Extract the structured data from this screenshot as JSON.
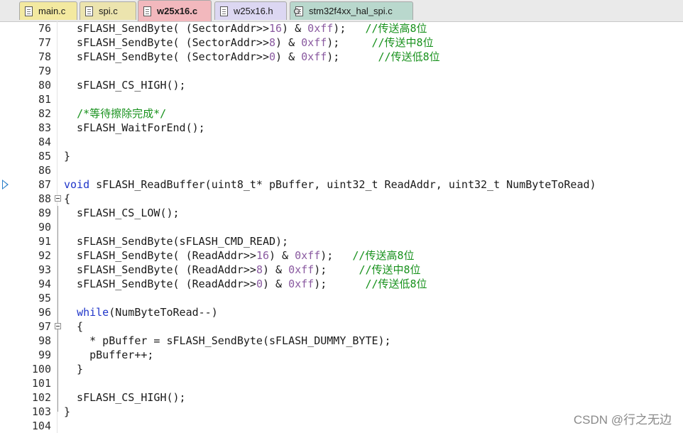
{
  "tabs": [
    {
      "label": "main.c",
      "color": "#f3e9a0"
    },
    {
      "label": "spi.c",
      "color": "#ece4ae"
    },
    {
      "label": "w25x16.c",
      "color": "#f2b8bd",
      "active": true
    },
    {
      "label": "w25x16.h",
      "color": "#dcd7f2"
    },
    {
      "label": "stm32f4xx_hal_spi.c",
      "color": "#b9d8cd"
    }
  ],
  "lines": [
    {
      "n": "76",
      "code": "  sFLASH_SendByte( (SectorAddr>>16) & 0xff);   //传送高8位"
    },
    {
      "n": "77",
      "code": "  sFLASH_SendByte( (SectorAddr>>8) & 0xff);     //传送中8位"
    },
    {
      "n": "78",
      "code": "  sFLASH_SendByte( (SectorAddr>>0) & 0xff);      //传送低8位"
    },
    {
      "n": "79",
      "code": ""
    },
    {
      "n": "80",
      "code": "  sFLASH_CS_HIGH();"
    },
    {
      "n": "81",
      "code": ""
    },
    {
      "n": "82",
      "code": "  /*等待擦除完成*/"
    },
    {
      "n": "83",
      "code": "  sFLASH_WaitForEnd();"
    },
    {
      "n": "84",
      "code": ""
    },
    {
      "n": "85",
      "code": "}"
    },
    {
      "n": "86",
      "code": ""
    },
    {
      "n": "87",
      "code": "void sFLASH_ReadBuffer(uint8_t* pBuffer, uint32_t ReadAddr, uint32_t NumByteToRead)"
    },
    {
      "n": "88",
      "code": "{"
    },
    {
      "n": "89",
      "code": "  sFLASH_CS_LOW();"
    },
    {
      "n": "90",
      "code": ""
    },
    {
      "n": "91",
      "code": "  sFLASH_SendByte(sFLASH_CMD_READ);"
    },
    {
      "n": "92",
      "code": "  sFLASH_SendByte( (ReadAddr>>16) & 0xff);   //传送高8位"
    },
    {
      "n": "93",
      "code": "  sFLASH_SendByte( (ReadAddr>>8) & 0xff);     //传送中8位"
    },
    {
      "n": "94",
      "code": "  sFLASH_SendByte( (ReadAddr>>0) & 0xff);      //传送低8位"
    },
    {
      "n": "95",
      "code": ""
    },
    {
      "n": "96",
      "code": "  while(NumByteToRead--)"
    },
    {
      "n": "97",
      "code": "  {"
    },
    {
      "n": "98",
      "code": "    * pBuffer = sFLASH_SendByte(sFLASH_DUMMY_BYTE);"
    },
    {
      "n": "99",
      "code": "    pBuffer++;"
    },
    {
      "n": "100",
      "code": "  }"
    },
    {
      "n": "101",
      "code": ""
    },
    {
      "n": "102",
      "code": "  sFLASH_CS_HIGH();"
    },
    {
      "n": "103",
      "code": "}"
    },
    {
      "n": "104",
      "code": ""
    }
  ],
  "watermark": "CSDN @行之无边",
  "colors": {
    "keyword": "#1f35c9",
    "comment": "#17911c",
    "number": "#8a5aa0"
  }
}
